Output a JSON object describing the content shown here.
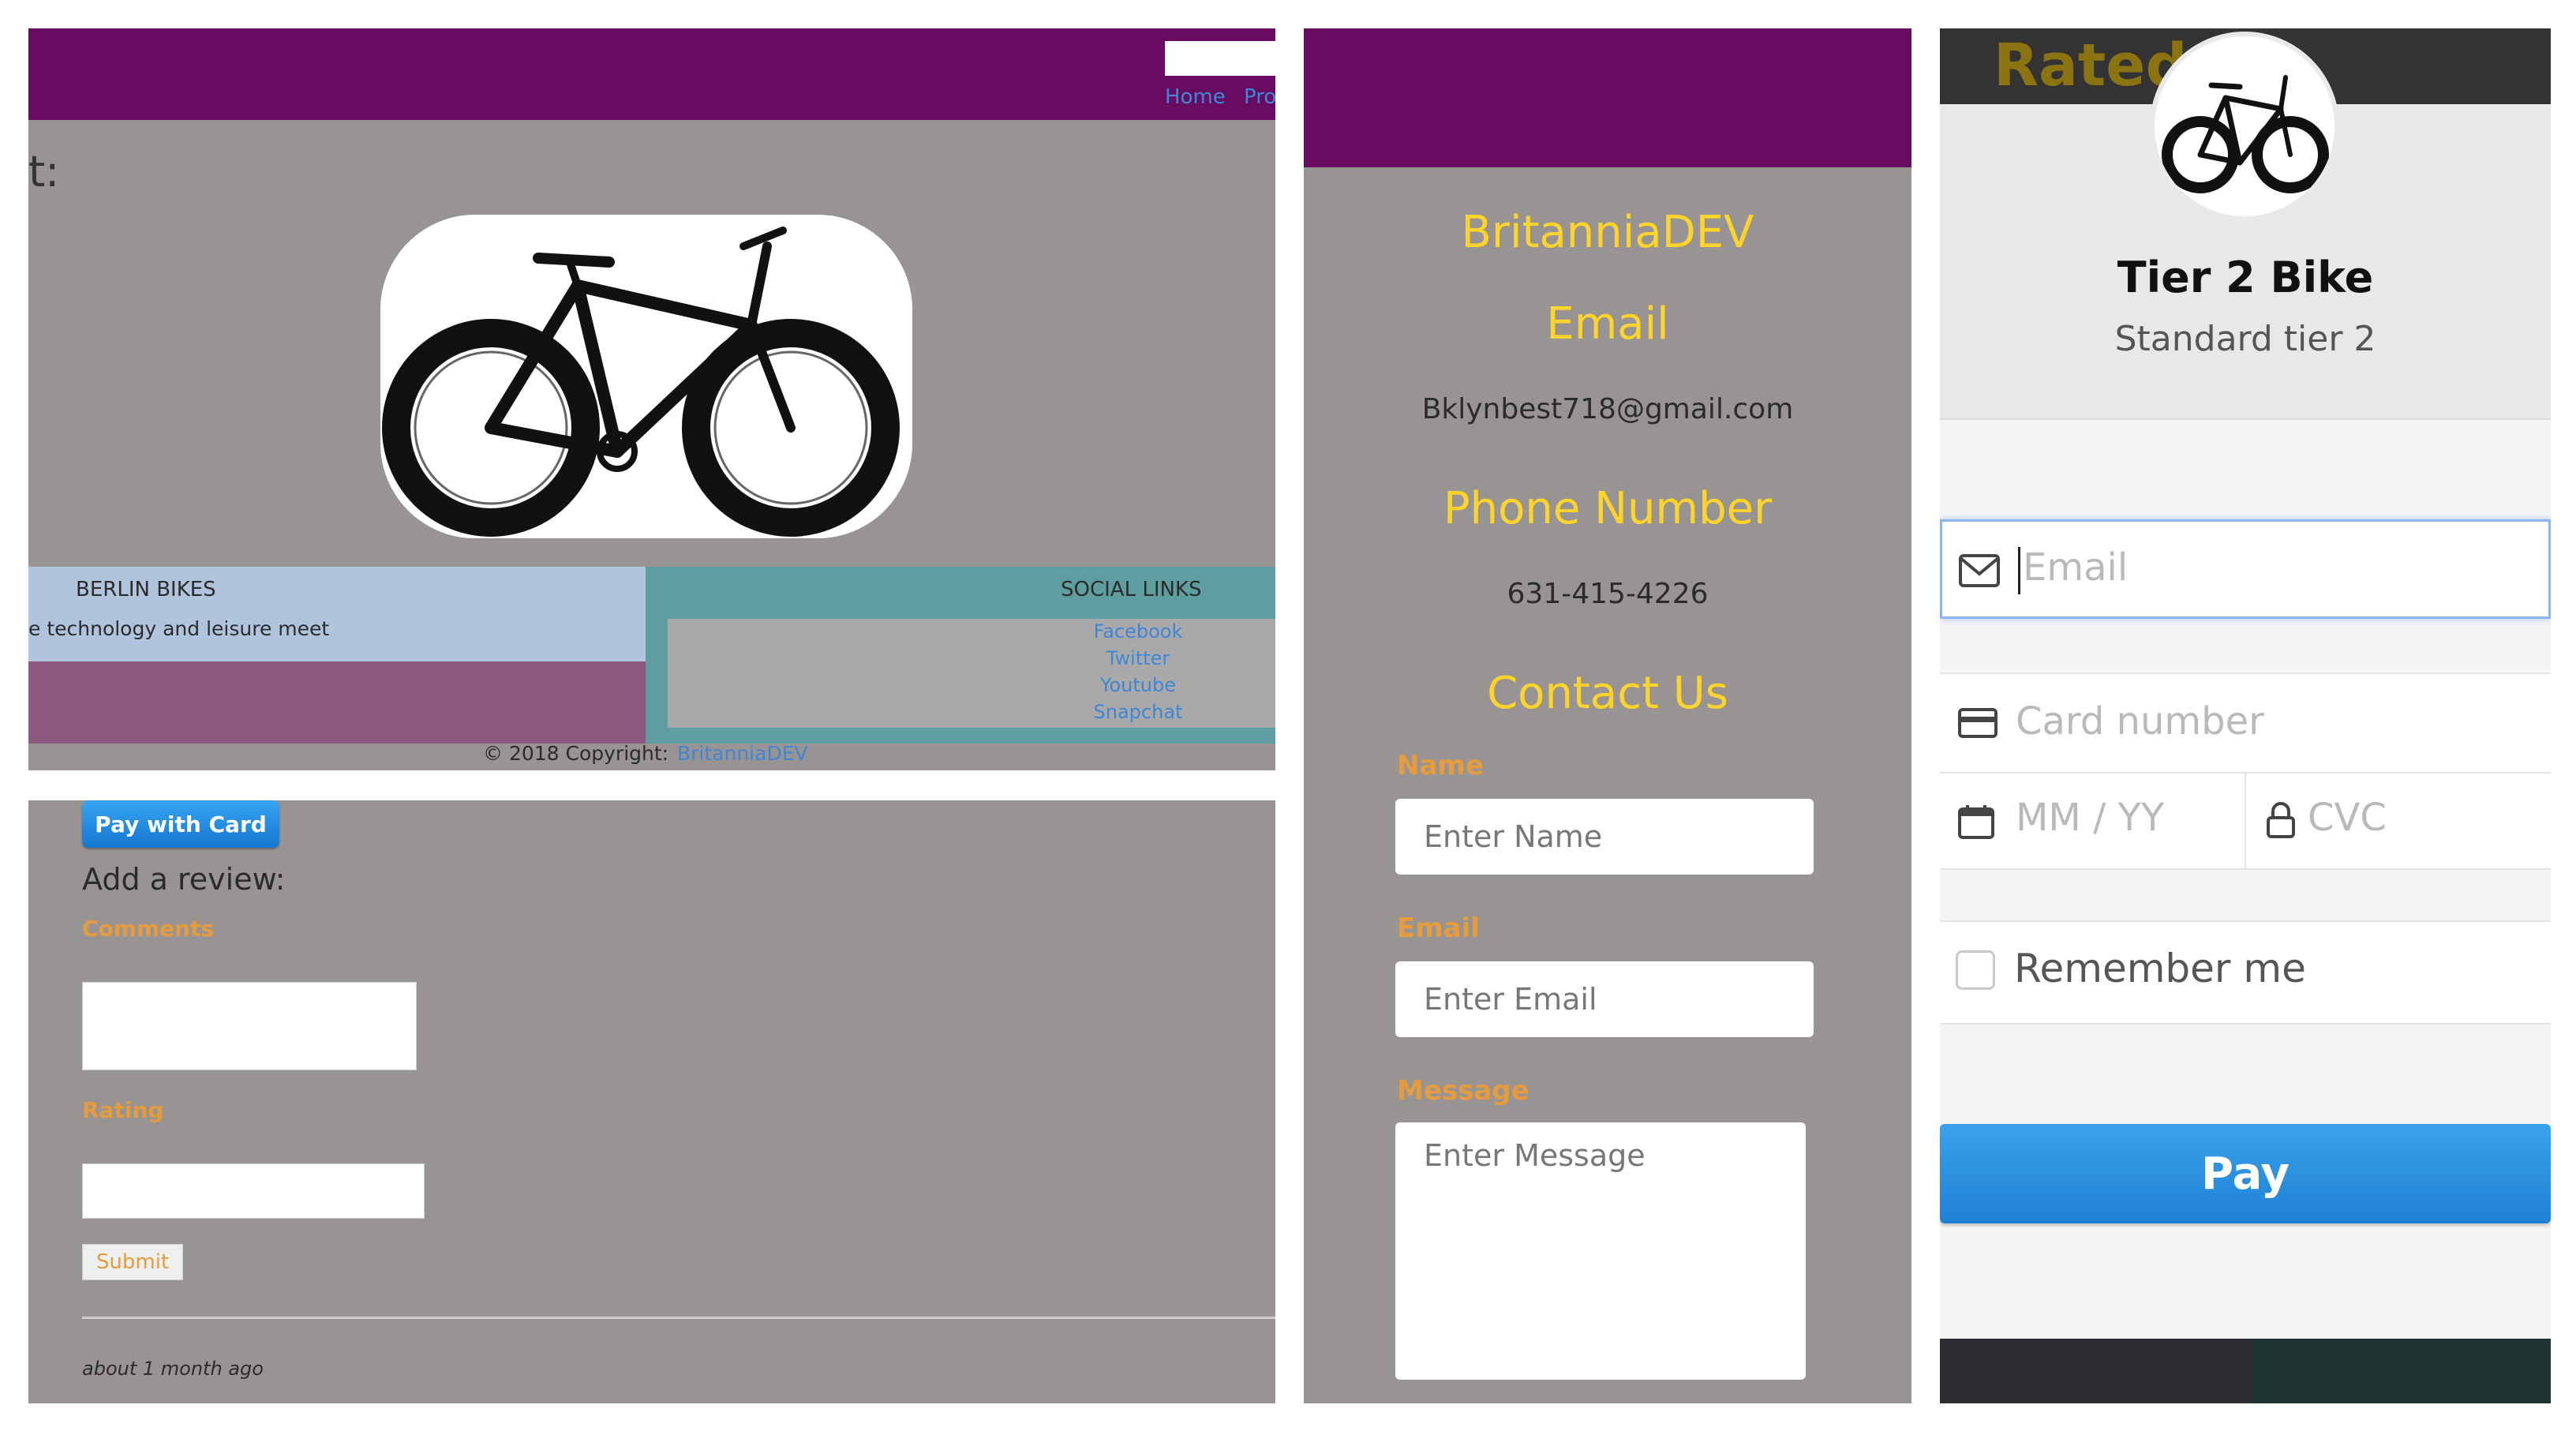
{
  "panel_a": {
    "nav": [
      "Home",
      "Pro"
    ],
    "heading_fragment": "t:",
    "footer": {
      "brand": "BERLIN BIKES",
      "tagline": "e technology and leisure meet",
      "social_title": "SOCIAL LINKS",
      "social_links": [
        "Facebook",
        "Twitter",
        "Youtube",
        "Snapchat"
      ],
      "copyright": "© 2018 Copyright:",
      "copyright_link": "BritanniaDEV"
    }
  },
  "panel_b": {
    "pay_button": "Pay with Card",
    "review_heading": "Add a review:",
    "comments_label": "Comments",
    "rating_label": "Rating",
    "submit_label": "Submit",
    "timestamp": "about 1 month ago"
  },
  "panel_c": {
    "brand": "BritanniaDEV",
    "email_heading": "Email",
    "email_value": "Bklynbest718@gmail.com",
    "phone_heading": "Phone Number",
    "phone_value": "631-415-4226",
    "contact_heading": "Contact Us",
    "form": {
      "name_label": "Name",
      "name_placeholder": "Enter Name",
      "email_label": "Email",
      "email_placeholder": "Enter Email",
      "message_label": "Message",
      "message_placeholder": "Enter Message"
    }
  },
  "panel_d": {
    "background_title": "Rated Comments",
    "product_title": "Tier 2 Bike",
    "product_subtitle": "Standard tier 2",
    "email_placeholder": "Email",
    "card_placeholder": "Card number",
    "expiry_placeholder": "MM / YY",
    "cvc_placeholder": "CVC",
    "remember_label": "Remember me",
    "pay_button": "Pay"
  },
  "colors": {
    "header_purple": "#680c62",
    "page_gray": "#999494",
    "accent_yellow": "#ffd42a",
    "label_orange": "#e69b3c",
    "link_blue": "#3f86d6",
    "stripe_blue": "#1f8ae0"
  }
}
